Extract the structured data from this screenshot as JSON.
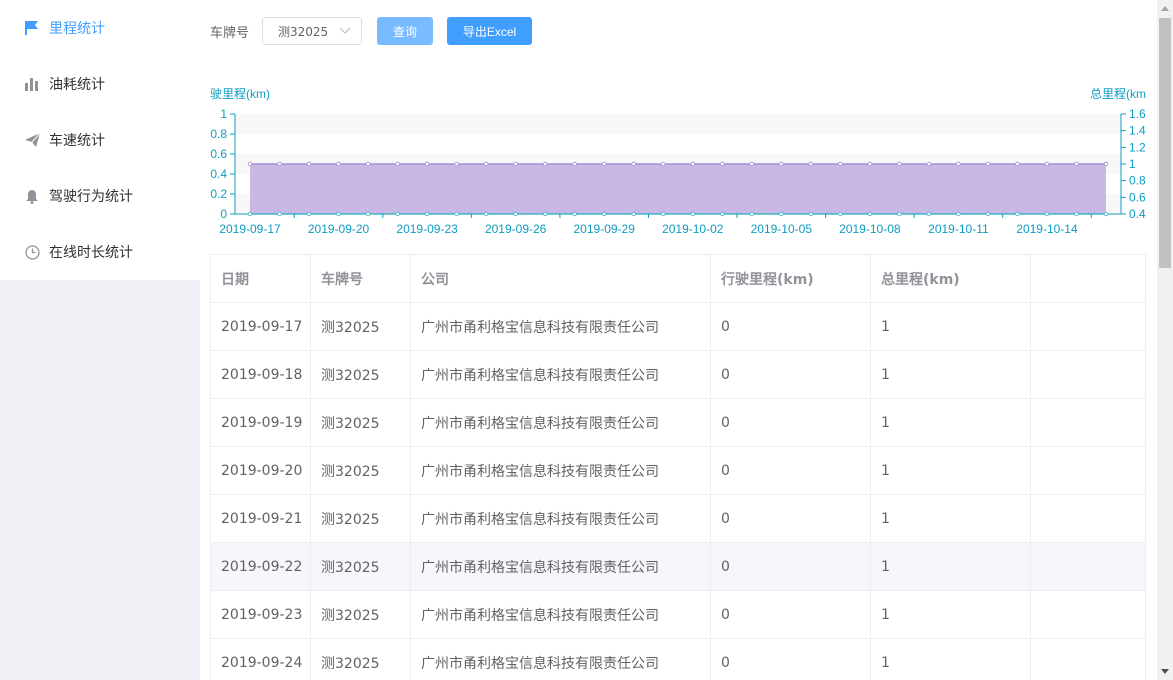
{
  "sidebar": {
    "items": [
      {
        "label": "里程统计",
        "icon": "flag-icon",
        "active": true
      },
      {
        "label": "油耗统计",
        "icon": "bar-chart-icon",
        "active": false
      },
      {
        "label": "车速统计",
        "icon": "paper-plane-icon",
        "active": false
      },
      {
        "label": "驾驶行为统计",
        "icon": "bell-icon",
        "active": false
      },
      {
        "label": "在线时长统计",
        "icon": "clock-icon",
        "active": false
      }
    ]
  },
  "toolbar": {
    "plate_label": "车牌号",
    "plate_value": "测32025",
    "query_label": "查询",
    "export_label": "导出Excel"
  },
  "colors": {
    "accent": "#409eff",
    "axis": "#0e9cc2",
    "area_fill": "#c8b8e3",
    "area_line": "#a58fd4"
  },
  "chart_data": {
    "type": "area",
    "left_axis_label": "驶里程(km)",
    "right_axis_label": "总里程(km",
    "left_ticks": [
      "1",
      "0.8",
      "0.6",
      "0.4",
      "0.2",
      "0"
    ],
    "right_ticks": [
      "1.6",
      "1.4",
      "1.2",
      "1",
      "0.8",
      "0.6",
      "0.4"
    ],
    "x_tick_labels": [
      "2019-09-17",
      "2019-09-20",
      "2019-09-23",
      "2019-09-26",
      "2019-09-29",
      "2019-10-02",
      "2019-10-05",
      "2019-10-08",
      "2019-10-11",
      "2019-10-14"
    ],
    "ylim_left": [
      0,
      1
    ],
    "ylim_right": [
      0.4,
      1.6
    ],
    "x": [
      "2019-09-17",
      "2019-09-18",
      "2019-09-19",
      "2019-09-20",
      "2019-09-21",
      "2019-09-22",
      "2019-09-23",
      "2019-09-24",
      "2019-09-25",
      "2019-09-26",
      "2019-09-27",
      "2019-09-28",
      "2019-09-29",
      "2019-09-30",
      "2019-10-01",
      "2019-10-02",
      "2019-10-03",
      "2019-10-04",
      "2019-10-05",
      "2019-10-06",
      "2019-10-07",
      "2019-10-08",
      "2019-10-09",
      "2019-10-10",
      "2019-10-11",
      "2019-10-12",
      "2019-10-13",
      "2019-10-14",
      "2019-10-15",
      "2019-10-16"
    ],
    "series": [
      {
        "axis": "left",
        "values": [
          0,
          0,
          0,
          0,
          0,
          0,
          0,
          0,
          0,
          0,
          0,
          0,
          0,
          0,
          0,
          0,
          0,
          0,
          0,
          0,
          0,
          0,
          0,
          0,
          0,
          0,
          0,
          0,
          0,
          0
        ]
      },
      {
        "axis": "right",
        "values": [
          1,
          1,
          1,
          1,
          1,
          1,
          1,
          1,
          1,
          1,
          1,
          1,
          1,
          1,
          1,
          1,
          1,
          1,
          1,
          1,
          1,
          1,
          1,
          1,
          1,
          1,
          1,
          1,
          1,
          1
        ]
      }
    ],
    "grid": "banded"
  },
  "table": {
    "columns": [
      "日期",
      "车牌号",
      "公司",
      "行驶里程(km)",
      "总里程(km)"
    ],
    "rows": [
      [
        "2019-09-17",
        "测32025",
        "广州市甬利格宝信息科技有限责任公司",
        "0",
        "1"
      ],
      [
        "2019-09-18",
        "测32025",
        "广州市甬利格宝信息科技有限责任公司",
        "0",
        "1"
      ],
      [
        "2019-09-19",
        "测32025",
        "广州市甬利格宝信息科技有限责任公司",
        "0",
        "1"
      ],
      [
        "2019-09-20",
        "测32025",
        "广州市甬利格宝信息科技有限责任公司",
        "0",
        "1"
      ],
      [
        "2019-09-21",
        "测32025",
        "广州市甬利格宝信息科技有限责任公司",
        "0",
        "1"
      ],
      [
        "2019-09-22",
        "测32025",
        "广州市甬利格宝信息科技有限责任公司",
        "0",
        "1"
      ],
      [
        "2019-09-23",
        "测32025",
        "广州市甬利格宝信息科技有限责任公司",
        "0",
        "1"
      ],
      [
        "2019-09-24",
        "测32025",
        "广州市甬利格宝信息科技有限责任公司",
        "0",
        "1"
      ]
    ],
    "highlighted_row": 5
  }
}
